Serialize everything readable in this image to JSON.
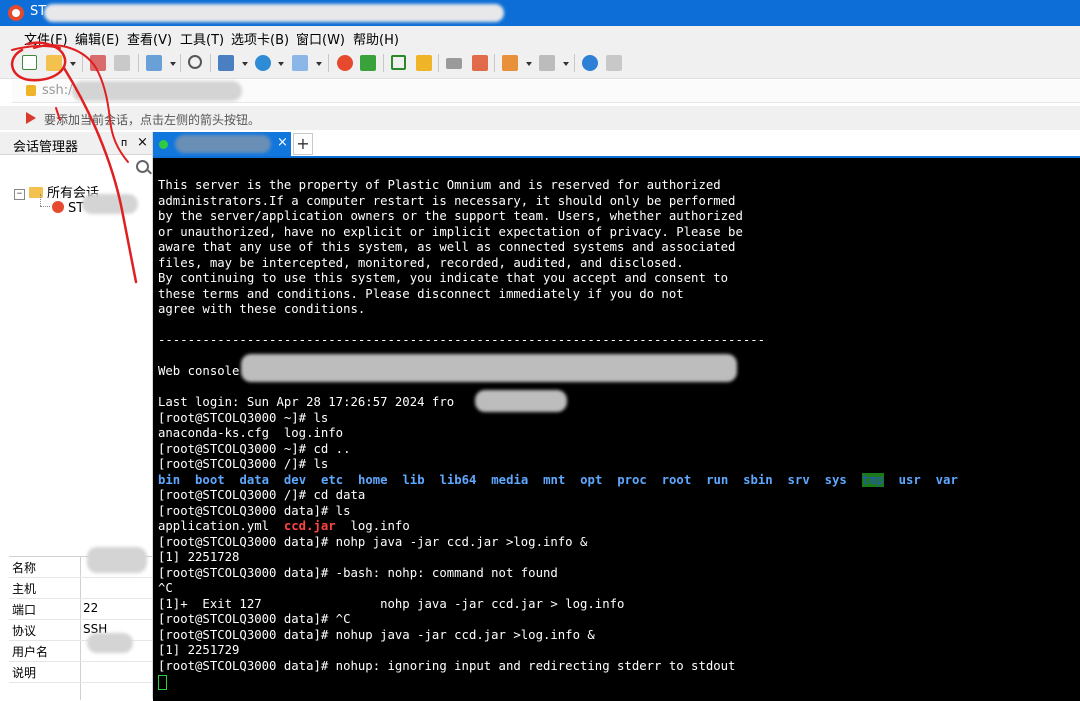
{
  "window": {
    "title": "ST"
  },
  "menu": [
    "文件(F)",
    "编辑(E)",
    "查看(V)",
    "工具(T)",
    "选项卡(B)",
    "窗口(W)",
    "帮助(H)"
  ],
  "toolbar_icons": [
    "new-session-icon",
    "open-folder-icon",
    "reconnect-icon",
    "disconnect-icon",
    "new-window-icon",
    "find-icon",
    "transfer-icon",
    "globe-icon",
    "font-icon",
    "xshell-icon",
    "xftp-icon",
    "fullscreen-icon",
    "lock-icon",
    "keyboard-icon",
    "highlight-icon",
    "compose-icon",
    "layout-icon",
    "help-icon",
    "chat-icon"
  ],
  "address": {
    "text": "ssh:/"
  },
  "hint": {
    "text": "要添加当前会话，点击左侧的箭头按钮。"
  },
  "sidebar": {
    "title": "会话管理器",
    "pin": "ᴨ",
    "close": "×",
    "tree": {
      "root": "所有会话",
      "expander": "−",
      "child": "ST"
    }
  },
  "properties": [
    {
      "key": "名称",
      "value": ""
    },
    {
      "key": "主机",
      "value": ""
    },
    {
      "key": "端口",
      "value": "22"
    },
    {
      "key": "协议",
      "value": "SSH"
    },
    {
      "key": "用户名",
      "value": ""
    },
    {
      "key": "说明",
      "value": ""
    }
  ],
  "tabs": {
    "close": "×",
    "add": "+"
  },
  "terminal": {
    "banner": [
      "This server is the property of Plastic Omnium and is reserved for authorized",
      "administrators.If a computer restart is necessary, it should only be performed",
      "by the server/application owners or the support team. Users, whether authorized",
      "or unauthorized, have no explicit or implicit expectation of privacy. Please be",
      "aware that any use of this system, as well as connected systems and associated",
      "files, may be intercepted, monitored, recorded, audited, and disclosed.",
      "By continuing to use this system, you indicate that you accept and consent to",
      "these terms and conditions. Please disconnect immediately if you do not",
      "agree with these conditions."
    ],
    "separator": "----------------------------------------------------------------------------------",
    "web_console": "Web console",
    "last_login": "Last login: Sun Apr 28 17:26:57 2024 fro",
    "cmd_ls1": "[root@STCOLQ3000 ~]# ls",
    "ls_home": "anaconda-ks.cfg  log.info",
    "cmd_cd": "[root@STCOLQ3000 ~]# cd ..",
    "cmd_ls2": "[root@STCOLQ3000 /]# ls",
    "root_dirs": [
      "bin",
      "boot",
      "data",
      "dev",
      "etc",
      "home",
      "lib",
      "lib64",
      "media",
      "mnt",
      "opt",
      "proc",
      "root",
      "run",
      "sbin",
      "srv",
      "sys",
      "tmp",
      "usr",
      "var"
    ],
    "cmd_cd_data": "[root@STCOLQ3000 /]# cd data",
    "cmd_ls3": "[root@STCOLQ3000 data]# ls",
    "ls_data_a": "application.yml  ",
    "ls_data_jar": "ccd.jar",
    "ls_data_b": "  log.info",
    "cmd_nohp": "[root@STCOLQ3000 data]# nohp java -jar ccd.jar >log.info &",
    "pid1": "[1] 2251728",
    "err_nohp": "[root@STCOLQ3000 data]# -bash: nohp: command not found",
    "ctrl_c": "^C",
    "exit_line": "[1]+  Exit 127                nohp java -jar ccd.jar > log.info",
    "cmd_ctrl_c": "[root@STCOLQ3000 data]# ^C",
    "cmd_nohup": "[root@STCOLQ3000 data]# nohup java -jar ccd.jar >log.info &",
    "pid2": "[1] 2251729",
    "nohup_msg": "[root@STCOLQ3000 data]# nohup: ignoring input and redirecting stderr to stdout"
  },
  "colors": {
    "titlebar": "#0c6ed6",
    "terminal_bg": "#000000",
    "dir_blue": "#5fa8ff",
    "jar_red": "#ff4444",
    "cursor_green": "#2ecc40",
    "annotation_red": "#e02020"
  }
}
